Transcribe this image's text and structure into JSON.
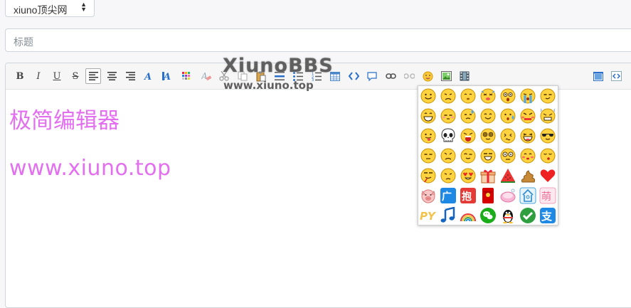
{
  "forum_select": {
    "value": "xiuno顶尖网"
  },
  "title_input": {
    "placeholder": "标题"
  },
  "toolbar": {
    "bold": "B",
    "italic": "I",
    "underline": "U",
    "strike": "S"
  },
  "content": {
    "line1": "极简编辑器",
    "line2": "www.xiuno.top"
  },
  "watermark": {
    "main": "XiunoBBS",
    "sub": "www.xiuno.top"
  },
  "colors": {
    "text_pink": "#e36ff0",
    "emoji_yellow": "#ffd23f",
    "emoji_outline": "#c79000"
  },
  "emoji_panel": {
    "rows": [
      [
        "smile-emoji",
        "sad-emoji",
        "shy-emoji",
        "dizzy-emoji",
        "scared-emoji",
        "crying-emoji",
        "smirk-emoji"
      ],
      [
        "grin-emoji",
        "sleepy-emoji",
        "sweat-emoji",
        "happy-emoji",
        "nervous-emoji",
        "angry-emoji",
        "steam-emoji"
      ],
      [
        "tongue-emoji",
        "skull-emoji",
        "shout-emoji",
        "spiral-eyes-emoji",
        "confused-emoji",
        "laugh-emoji",
        "sunglasses-emoji"
      ],
      [
        "dull-emoji",
        "frown-emoji",
        "wink-emoji",
        "squint-emoji",
        "surprised-emoji",
        "blush-emoji",
        "kiss-emoji"
      ],
      [
        "nosebleed-emoji",
        "weary-emoji",
        "heart-eyes-emoji",
        "gift-emoji",
        "watermelon-emoji",
        "poop-emoji",
        "heart-emoji"
      ],
      [
        "pig-emoji",
        "ad-sticker",
        "hug-sticker",
        "red-envelope-sticker",
        "soap-sticker",
        "house-sticker",
        "cute-sticker"
      ],
      [
        "py-sticker",
        "music-note-emoji",
        "rainbow-emoji",
        "wechat-logo",
        "qq-penguin-logo",
        "check-badge",
        "alipay-logo"
      ]
    ]
  }
}
